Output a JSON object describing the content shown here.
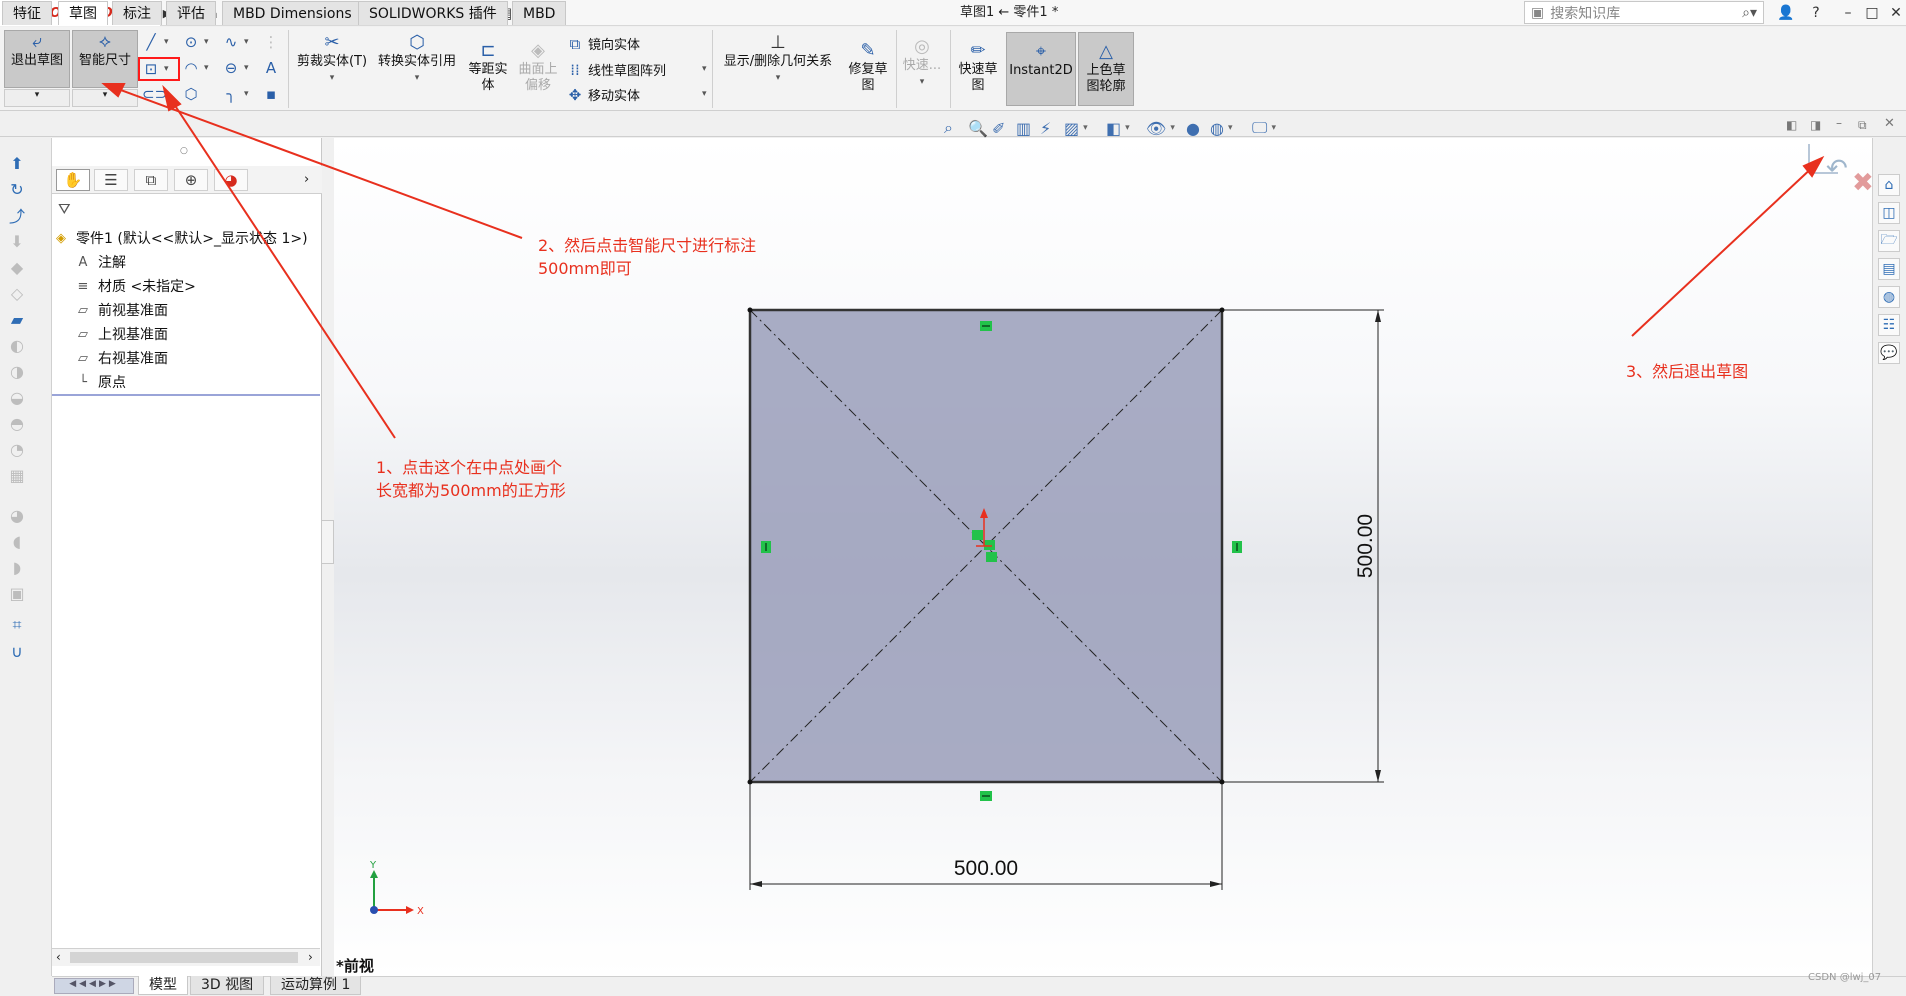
{
  "titlebar": {
    "app_name": "SOLIDWORKS",
    "doc_title": "草图1 ← 零件1 *",
    "search_placeholder": "搜索知识库",
    "help_label": "?",
    "minimize": "–",
    "restore": "□",
    "close": "✕"
  },
  "command_manager": {
    "exit_sketch": "退出草图",
    "smart_dimension": "智能尺寸",
    "trim_entities": "剪裁实体(T)",
    "convert_entities": "转换实体引用",
    "offset_entities": "等距实体",
    "offset_on_surface": "曲面上偏移",
    "mirror_entities": "镜向实体",
    "linear_pattern": "线性草图阵列",
    "move_entities": "移动实体",
    "display_delete_relations": "显示/删除几何关系",
    "repair_sketch": "修复草图",
    "quick_snaps_disabled": "快速...",
    "rapid_sketch": "快速草图",
    "instant2d": "Instant2D",
    "shaded_contours": "上色草图轮廓"
  },
  "tabs": [
    "特征",
    "草图",
    "标注",
    "评估",
    "MBD Dimensions",
    "SOLIDWORKS 插件",
    "MBD"
  ],
  "active_tab": "草图",
  "feature_tree": {
    "root": "零件1 (默认<<默认>_显示状态 1>)",
    "items": [
      "注解",
      "材质 <未指定>",
      "前视基准面",
      "上视基准面",
      "右视基准面",
      "原点"
    ]
  },
  "bottom_tabs": [
    "模型",
    "3D 视图",
    "运动算例 1"
  ],
  "active_bottom_tab": "模型",
  "graphics": {
    "view_label": "*前视",
    "dim_horizontal": "500.00",
    "dim_vertical": "500.00",
    "axis_x": "X",
    "axis_y": "Y"
  },
  "annotations": {
    "step1_line1": "1、点击这个在中点处画个",
    "step1_line2": "长宽都为500mm的正方形",
    "step2_line1": "2、然后点击智能尺寸进行标注",
    "step2_line2": "500mm即可",
    "step3": "3、然后退出草图"
  },
  "watermark": "CSDN @lwj_07",
  "colors": {
    "annotation_red": "#e8301e",
    "sketch_fill": "#9b9fbb",
    "relation_green": "#22c24a",
    "brand_red": "#d52b1e"
  }
}
